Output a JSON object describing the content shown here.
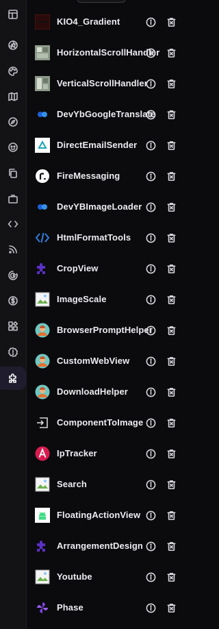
{
  "extensions": [
    {
      "name": "KIO4_Gradient",
      "icon": "gradient-swatch-icon"
    },
    {
      "name": "HorizontalScrollHandler",
      "icon": "scroll-handler-icon"
    },
    {
      "name": "VerticalScrollHandler",
      "icon": "scroll-handler-icon"
    },
    {
      "name": "DevYbGoogleTranslate",
      "icon": "blue-dots-icon"
    },
    {
      "name": "DirectEmailSender",
      "icon": "triangle-logo-icon"
    },
    {
      "name": "FireMessaging",
      "icon": "r-logo-icon"
    },
    {
      "name": "DevYBImageLoader",
      "icon": "blue-dots-icon"
    },
    {
      "name": "HtmlFormatTools",
      "icon": "code-brackets-icon"
    },
    {
      "name": "CropView",
      "icon": "puzzle-icon"
    },
    {
      "name": "ImageScale",
      "icon": "broken-image-icon"
    },
    {
      "name": "BrowserPromptHelper",
      "icon": "avatar-icon"
    },
    {
      "name": "CustomWebView",
      "icon": "avatar-icon"
    },
    {
      "name": "DownloadHelper",
      "icon": "avatar-icon"
    },
    {
      "name": "ComponentToImage",
      "icon": "export-box-icon"
    },
    {
      "name": "IpTracker",
      "icon": "letter-a-logo-icon"
    },
    {
      "name": "Search",
      "icon": "broken-image-icon"
    },
    {
      "name": "FloatingActionView",
      "icon": "android-icon"
    },
    {
      "name": "ArrangementDesign",
      "icon": "puzzle-icon"
    },
    {
      "name": "Youtube",
      "icon": "broken-image-icon"
    },
    {
      "name": "Phase",
      "icon": "pinwheel-icon"
    }
  ],
  "sidebar_icons": [
    "layout-icon",
    "aperture-icon",
    "palette-icon",
    "map-icon",
    "compass-icon",
    "emoji-icon",
    "copy-icon",
    "briefcase-icon",
    "code-icon",
    "rss-icon",
    "google-icon",
    "dollar-icon",
    "widgets-icon",
    "alert-icon",
    "extension-icon"
  ],
  "active_sidebar_icon": "extension-icon",
  "colors": {
    "background": "#0b0b0d",
    "sidebar": "#131316",
    "active": "#1f1c2e",
    "text": "#ececf2"
  }
}
